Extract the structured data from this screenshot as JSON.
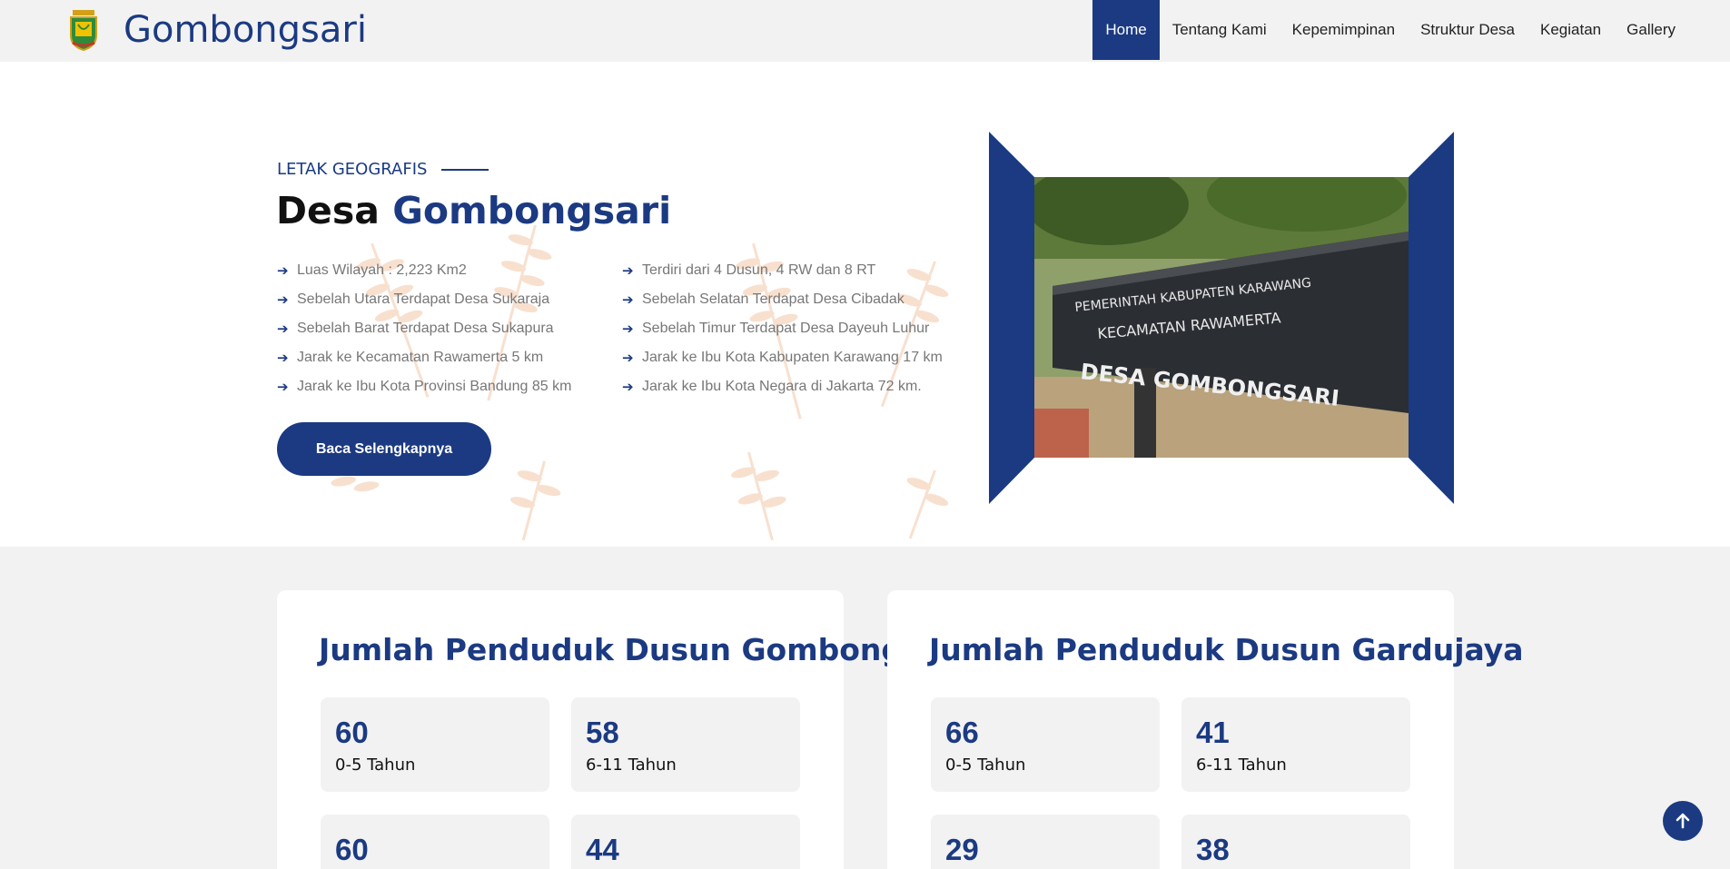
{
  "brand": {
    "name": "Gombongsari",
    "logo_icon": "crest-logo"
  },
  "nav": {
    "items": [
      {
        "label": "Home",
        "active": true
      },
      {
        "label": "Tentang Kami"
      },
      {
        "label": "Kepemimpinan"
      },
      {
        "label": "Struktur Desa"
      },
      {
        "label": "Kegiatan"
      },
      {
        "label": "Gallery"
      }
    ]
  },
  "hero": {
    "eyebrow": "LETAK GEOGRAFIS",
    "title_main": "Desa ",
    "title_accent": "Gombongsari",
    "facts_left": [
      "Luas Wilayah : 2,223 Km2",
      "Sebelah Utara Terdapat Desa Sukaraja",
      "Sebelah Barat Terdapat Desa Sukapura",
      "Jarak ke Kecamatan Rawamerta 5 km",
      "Jarak ke Ibu Kota Provinsi Bandung 85 km"
    ],
    "facts_right": [
      "Terdiri dari 4 Dusun, 4 RW dan 8 RT",
      "Sebelah Selatan Terdapat Desa Cibadak",
      "Sebelah Timur Terdapat Desa Dayeuh Luhur",
      "Jarak ke Ibu Kota Kabupaten Karawang 17 km",
      "Jarak ke Ibu Kota Negara di Jakarta 72 km."
    ],
    "cta_label": "Baca Selengkapnya",
    "photo": {
      "sign_line1": "PEMERINTAH KABUPATEN KARAWANG",
      "sign_line2": "KECAMATAN RAWAMERTA",
      "sign_line3": "DESA GOMBONGSARI"
    }
  },
  "stats": {
    "cards": [
      {
        "title": "Jumlah Penduduk Dusun Gombong",
        "items": [
          {
            "value": "60",
            "label": "0-5 Tahun"
          },
          {
            "value": "58",
            "label": "6-11 Tahun"
          },
          {
            "value": "60",
            "label": ""
          },
          {
            "value": "44",
            "label": ""
          }
        ]
      },
      {
        "title": "Jumlah Penduduk Dusun Gardujaya",
        "items": [
          {
            "value": "66",
            "label": "0-5 Tahun"
          },
          {
            "value": "41",
            "label": "6-11 Tahun"
          },
          {
            "value": "29",
            "label": ""
          },
          {
            "value": "38",
            "label": ""
          }
        ]
      }
    ]
  },
  "colors": {
    "primary": "#1b3a82",
    "background_alt": "#f2f2f2",
    "accent_wheat": "#f7d9c4"
  },
  "icons": {
    "fact_arrow": "arrow-right-icon",
    "back_to_top": "arrow-up-icon"
  }
}
